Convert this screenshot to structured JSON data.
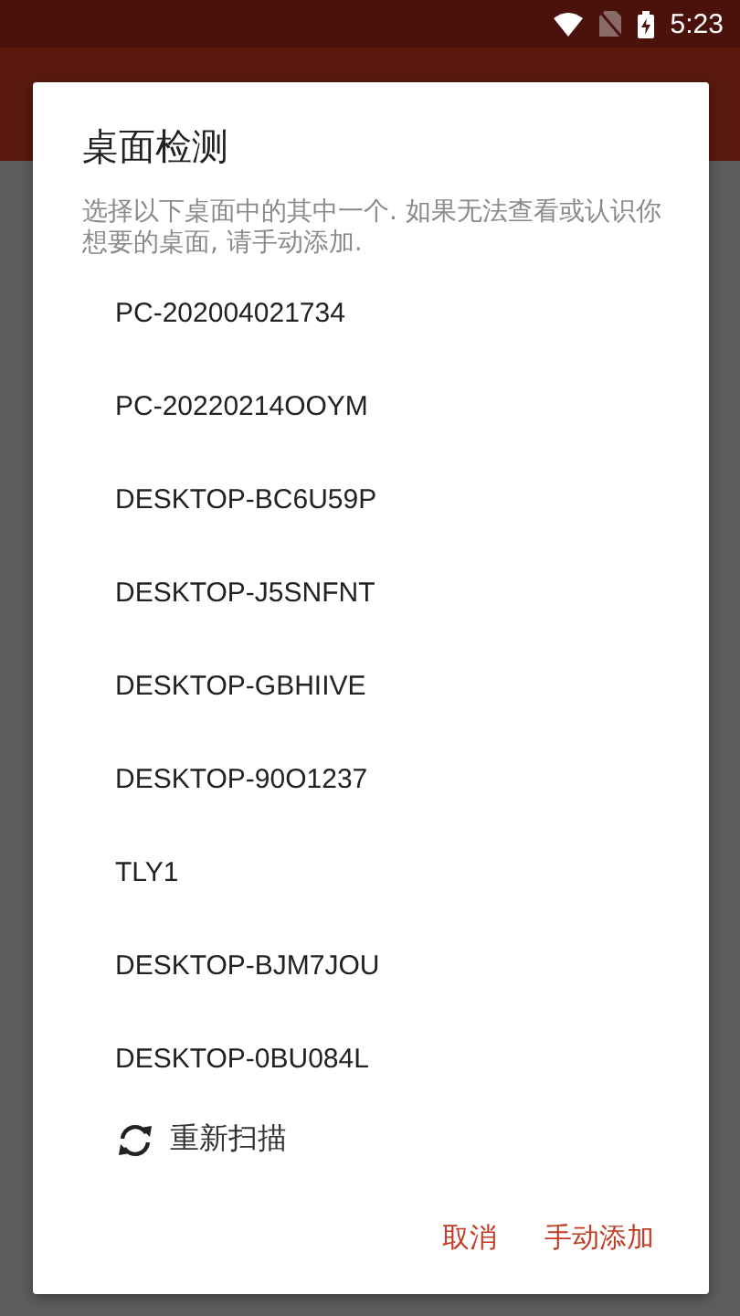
{
  "status_bar": {
    "time": "5:23"
  },
  "dialog": {
    "title": "桌面检测",
    "message": "选择以下桌面中的其中一个. 如果无法查看或认识你想要的桌面, 请手动添加.",
    "desktops": [
      {
        "name": "PC-202004021734"
      },
      {
        "name": "PC-20220214OOYM"
      },
      {
        "name": "DESKTOP-BC6U59P"
      },
      {
        "name": "DESKTOP-J5SNFNT"
      },
      {
        "name": "DESKTOP-GBHIIVE"
      },
      {
        "name": "DESKTOP-90O1237"
      },
      {
        "name": "TLY1"
      },
      {
        "name": "DESKTOP-BJM7JOU"
      },
      {
        "name": "DESKTOP-0BU084L"
      }
    ],
    "rescan": "重新扫描",
    "buttons": [
      "取消",
      "手动添加"
    ]
  }
}
